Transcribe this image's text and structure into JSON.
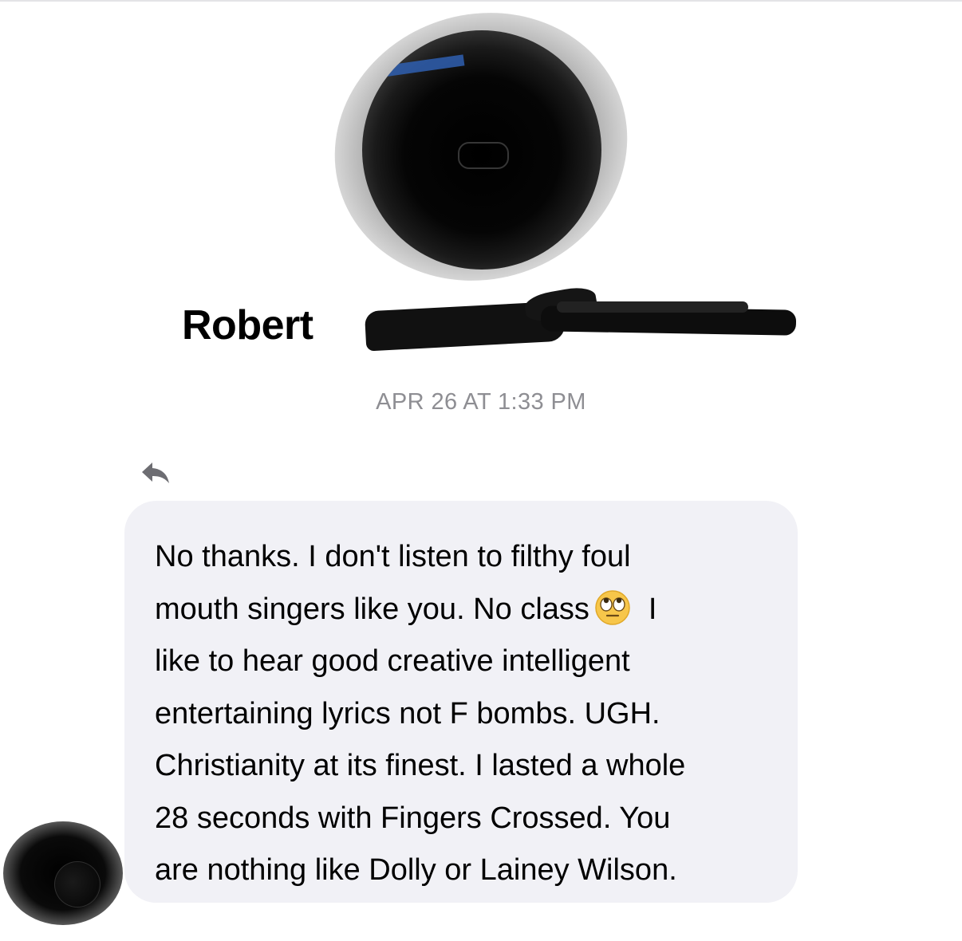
{
  "header": {
    "contact_first_name": "Robert"
  },
  "thread": {
    "timestamp": "APR 26 AT 1:33 PM"
  },
  "message": {
    "lines": [
      "No thanks. I don't listen to filthy foul",
      "mouth singers like you. No class",
      "like to hear good creative intelligent",
      "entertaining lyrics not F bombs. UGH.",
      "Christianity at its finest. I lasted a whole",
      "28 seconds with Fingers Crossed. You",
      "are nothing like Dolly or Lainey Wilson."
    ],
    "line2_after_emoji": "I",
    "emoji": "eye-roll-emoji"
  },
  "colors": {
    "bubble_background": "#f1f1f6",
    "timestamp_text": "#8e8e93",
    "reply_icon": "#6d6d72",
    "emoji_face": "#f7c64a"
  },
  "icons": {
    "reply": "reply-arrow-icon"
  }
}
